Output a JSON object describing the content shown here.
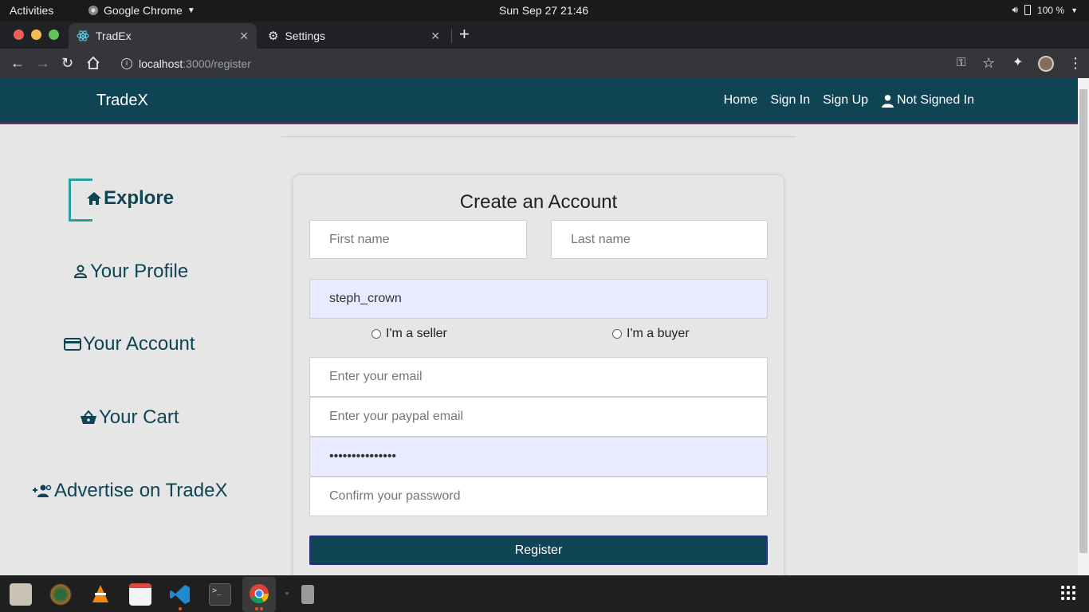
{
  "system": {
    "activities_label": "Activities",
    "app_menu_label": "Google Chrome",
    "clock": "Sun Sep 27  21:46",
    "battery": "100 %"
  },
  "browser": {
    "tabs": [
      {
        "label": "TradEx"
      },
      {
        "label": "Settings"
      }
    ],
    "url_host": "localhost",
    "url_path": ":3000/register"
  },
  "navbar": {
    "brand": "TradeX",
    "links": {
      "home": "Home",
      "sign_in": "Sign In",
      "sign_up": "Sign Up",
      "user_status": "Not Signed In"
    }
  },
  "sidebar": {
    "items": [
      {
        "label": "Explore",
        "icon": "home-icon"
      },
      {
        "label": "Your Profile",
        "icon": "person-icon"
      },
      {
        "label": "Your Account",
        "icon": "credit-card-icon"
      },
      {
        "label": "Your Cart",
        "icon": "basket-icon"
      },
      {
        "label": "Advertise on TradeX",
        "icon": "person-add-icon"
      }
    ]
  },
  "form": {
    "title": "Create an Account",
    "first_name_placeholder": "First name",
    "last_name_placeholder": "Last name",
    "username_value": "steph_crown",
    "seller_label": "I'm a seller",
    "buyer_label": "I'm a buyer",
    "email_placeholder": "Enter your email",
    "paypal_placeholder": "Enter your paypal email",
    "password_value": "•••••••••••••••",
    "confirm_placeholder": "Confirm your password",
    "register_label": "Register"
  },
  "colors": {
    "navbar_bg": "#0f4455",
    "accent_teal": "#2a9d9d",
    "autofill_bg": "#e8eaff"
  }
}
